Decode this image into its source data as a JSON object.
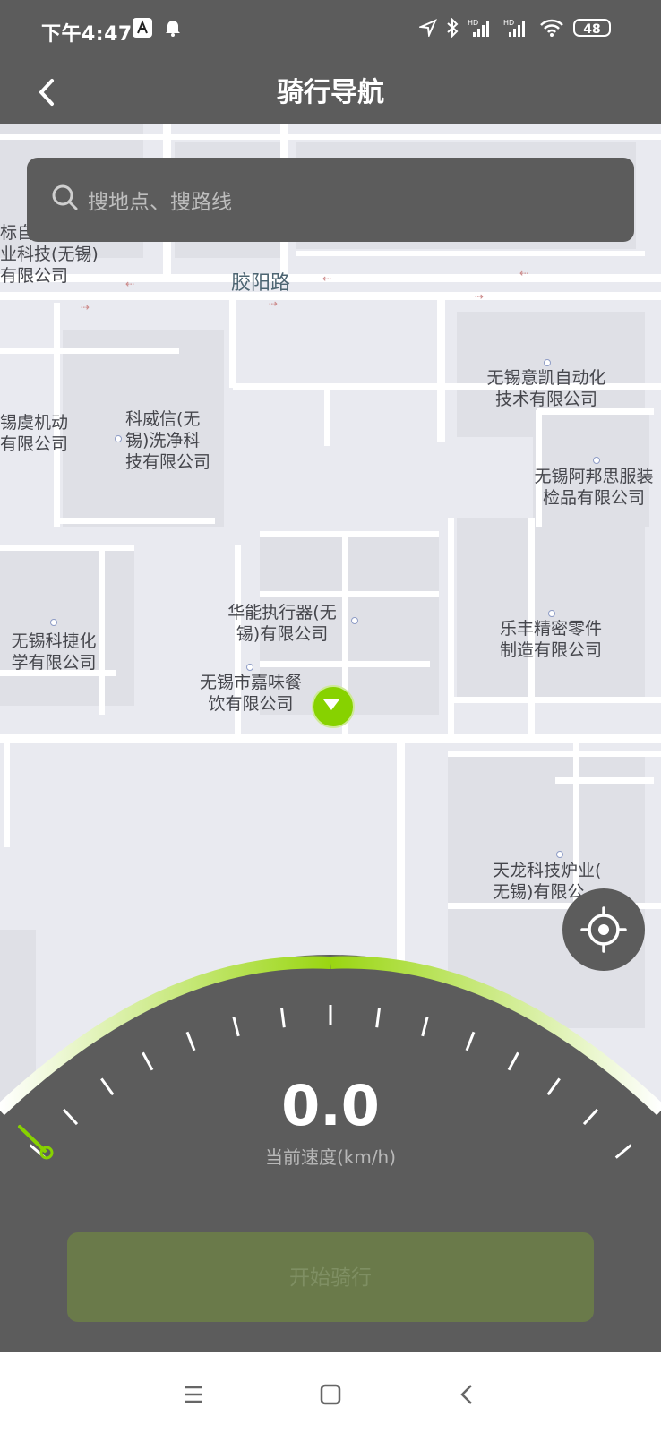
{
  "status_bar": {
    "time": "下午4:47",
    "battery": "48",
    "icons": [
      "app-icon",
      "bell-icon",
      "location-arrow-icon",
      "bluetooth-icon",
      "signal-hd-icon",
      "signal-hd-icon",
      "wifi-icon",
      "battery-icon"
    ]
  },
  "header": {
    "title": "骑行导航",
    "back_icon": "chevron-left-icon"
  },
  "search": {
    "placeholder": "搜地点、搜路线",
    "icon": "search-icon"
  },
  "map": {
    "road_name": "胶阳路",
    "places": [
      "标自动化分技\n业科技(无锡)\n有限公司",
      "无锡意凯自动化\n技术有限公司",
      "锡虞机动\n有限公司",
      "科威信(无\n锡)洗净科\n技有限公司",
      "无锡阿邦思服装\n检品有限公司",
      "华能执行器(无\n锡)有限公司",
      "无锡科捷化\n学有限公司",
      "乐丰精密零件\n制造有限公司",
      "无锡市嘉味餐\n饮有限公司",
      "天龙科技炉业(\n无锡)有限公"
    ]
  },
  "locate_button": {
    "icon": "crosshair-icon"
  },
  "speedometer": {
    "speed": "0.0",
    "label": "当前速度(km/h)",
    "speed_fraction": 0
  },
  "start_button": {
    "label": "开始骑行"
  },
  "system_nav": {
    "icons": [
      "menu-icon",
      "home-square-icon",
      "back-chevron-icon"
    ]
  },
  "colors": {
    "dark": "#5c5c5c",
    "accent": "#87d200",
    "map_bg": "#e9eaf0"
  }
}
